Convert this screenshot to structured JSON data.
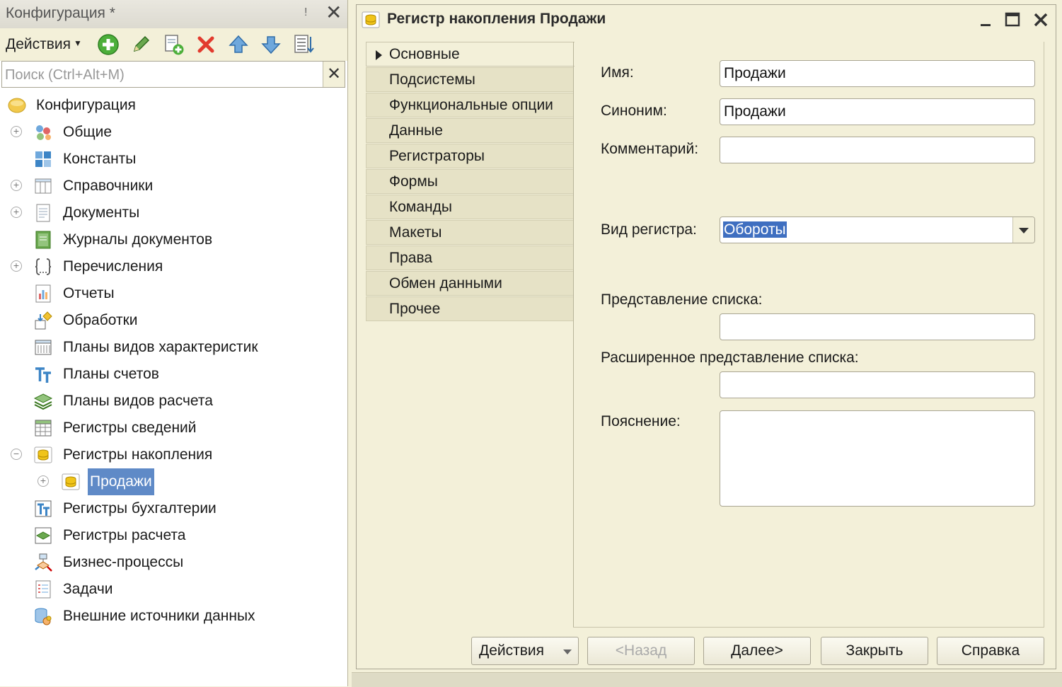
{
  "left_panel": {
    "title": "Конфигурация *",
    "pin_glyph": "ǃ",
    "close_glyph": "✕",
    "toolbar": {
      "actions_label": "Действия",
      "buttons": [
        "add-icon",
        "edit-icon",
        "copy-add-icon",
        "delete-icon",
        "move-up-icon",
        "move-down-icon",
        "sort-icon"
      ]
    },
    "search": {
      "placeholder": "Поиск (Ctrl+Alt+M)",
      "value": ""
    },
    "tree": [
      {
        "label": "Конфигурация",
        "icon": "configuration-icon",
        "expander": ""
      },
      {
        "label": "Общие",
        "icon": "common-icon",
        "expander": "+"
      },
      {
        "label": "Константы",
        "icon": "constants-icon",
        "expander": ""
      },
      {
        "label": "Справочники",
        "icon": "catalogs-icon",
        "expander": "+"
      },
      {
        "label": "Документы",
        "icon": "documents-icon",
        "expander": "+"
      },
      {
        "label": "Журналы документов",
        "icon": "document-journals-icon",
        "expander": ""
      },
      {
        "label": "Перечисления",
        "icon": "enumerations-icon",
        "expander": "+"
      },
      {
        "label": "Отчеты",
        "icon": "reports-icon",
        "expander": ""
      },
      {
        "label": "Обработки",
        "icon": "data-processors-icon",
        "expander": ""
      },
      {
        "label": "Планы видов характеристик",
        "icon": "chart-of-characteristic-types-icon",
        "expander": ""
      },
      {
        "label": "Планы счетов",
        "icon": "chart-of-accounts-icon",
        "expander": ""
      },
      {
        "label": "Планы видов расчета",
        "icon": "chart-of-calculation-types-icon",
        "expander": ""
      },
      {
        "label": "Регистры сведений",
        "icon": "information-registers-icon",
        "expander": ""
      },
      {
        "label": "Регистры накопления",
        "icon": "accumulation-registers-icon",
        "expander": "−"
      },
      {
        "label": "Продажи",
        "icon": "accumulation-register-icon",
        "expander": "+",
        "selected": true
      },
      {
        "label": "Регистры бухгалтерии",
        "icon": "accounting-registers-icon",
        "expander": ""
      },
      {
        "label": "Регистры расчета",
        "icon": "calculation-registers-icon",
        "expander": ""
      },
      {
        "label": "Бизнес-процессы",
        "icon": "business-processes-icon",
        "expander": ""
      },
      {
        "label": "Задачи",
        "icon": "tasks-icon",
        "expander": ""
      },
      {
        "label": "Внешние источники данных",
        "icon": "external-data-sources-icon",
        "expander": ""
      }
    ]
  },
  "window": {
    "title": "Регистр накопления Продажи",
    "tabs": [
      "Основные",
      "Подсистемы",
      "Функциональные опции",
      "Данные",
      "Регистраторы",
      "Формы",
      "Команды",
      "Макеты",
      "Права",
      "Обмен данными",
      "Прочее"
    ],
    "active_tab": "Основные",
    "form": {
      "name_label": "Имя:",
      "name_value": "Продажи",
      "synonym_label": "Синоним:",
      "synonym_value": "Продажи",
      "comment_label": "Комментарий:",
      "comment_value": "",
      "register_type_label": "Вид регистра:",
      "register_type_value": "Обороты",
      "list_presentation_label": "Представление списка:",
      "list_presentation_value": "",
      "ext_list_presentation_label": "Расширенное представление списка:",
      "ext_list_presentation_value": "",
      "explanation_label": "Пояснение:",
      "explanation_value": ""
    },
    "buttons": {
      "actions": "Действия",
      "back": "<Назад",
      "next": "Далее>",
      "close": "Закрыть",
      "help": "Справка"
    }
  },
  "colors": {
    "background": "#f3f0d9",
    "selection": "#5f8ac7",
    "text_selection": "#3f6fc0"
  }
}
